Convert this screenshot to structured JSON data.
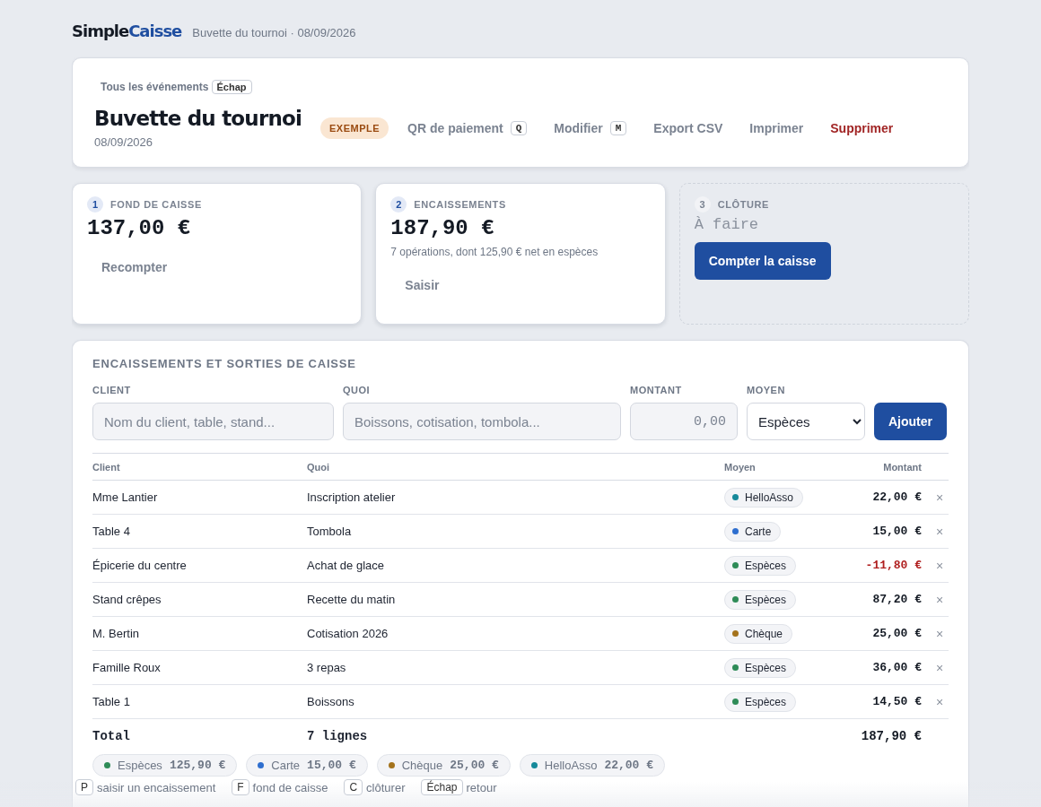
{
  "brand": {
    "first": "Simple",
    "second": "Caisse"
  },
  "breadcrumb": "Buvette du tournoi · 08/09/2026",
  "event": {
    "back_link": "Tous les événements",
    "back_key": "Échap",
    "title": "Buvette du tournoi",
    "date": "08/09/2026",
    "badge": "EXEMPLE",
    "actions": [
      {
        "label": "QR de paiement",
        "key": "Q",
        "kind": "normal"
      },
      {
        "label": "Modifier",
        "key": "M",
        "kind": "normal"
      },
      {
        "label": "Export CSV",
        "kind": "normal"
      },
      {
        "label": "Imprimer",
        "kind": "normal"
      },
      {
        "label": "Supprimer",
        "kind": "danger"
      }
    ]
  },
  "steps": [
    {
      "number": "1",
      "title": "FOND DE CAISSE",
      "done": true,
      "value": "137,00 €",
      "action": {
        "label": "Recompter",
        "kind": "link"
      }
    },
    {
      "number": "2",
      "title": "ENCAISSEMENTS",
      "done": true,
      "value": "187,90 €",
      "note": "7 opérations, dont 125,90 € net en espèces",
      "action": {
        "label": "Saisir",
        "kind": "link"
      }
    },
    {
      "number": "3",
      "title": "CLÔTURE",
      "done": false,
      "value": "À faire",
      "action": {
        "label": "Compter la caisse",
        "kind": "primary"
      }
    }
  ],
  "ledger": {
    "title": "ENCAISSEMENTS ET SORTIES DE CAISSE",
    "form": {
      "client": {
        "label": "CLIENT",
        "placeholder": "Nom du client, table, stand..."
      },
      "what": {
        "label": "QUOI",
        "placeholder": "Boissons, cotisation, tombola..."
      },
      "amount": {
        "label": "MONTANT",
        "placeholder": "0,00"
      },
      "method": {
        "label": "MOYEN",
        "value": "Espèces"
      },
      "submit": "Ajouter"
    },
    "columns": [
      "Client",
      "Quoi",
      "Moyen",
      "Montant"
    ],
    "rows": [
      {
        "client": "Mme Lantier",
        "what": "Inscription atelier",
        "method": "HelloAsso",
        "color": "#16899a",
        "amount": "22,00 €",
        "negative": false,
        "delete": "×"
      },
      {
        "client": "Table 4",
        "what": "Tombola",
        "method": "Carte",
        "color": "#2f6fcf",
        "amount": "15,00 €",
        "negative": false,
        "delete": "×"
      },
      {
        "client": "Épicerie du centre",
        "what": "Achat de glace",
        "method": "Espèces",
        "color": "#2e8b57",
        "amount": "-11,80 €",
        "negative": true,
        "delete": "×"
      },
      {
        "client": "Stand crêpes",
        "what": "Recette du matin",
        "method": "Espèces",
        "color": "#2e8b57",
        "amount": "87,20 €",
        "negative": false,
        "delete": "×"
      },
      {
        "client": "M. Bertin",
        "what": "Cotisation 2026",
        "method": "Chèque",
        "color": "#a4731c",
        "amount": "25,00 €",
        "negative": false,
        "delete": "×"
      },
      {
        "client": "Famille Roux",
        "what": "3 repas",
        "method": "Espèces",
        "color": "#2e8b57",
        "amount": "36,00 €",
        "negative": false,
        "delete": "×"
      },
      {
        "client": "Table 1",
        "what": "Boissons",
        "method": "Espèces",
        "color": "#2e8b57",
        "amount": "14,50 €",
        "negative": false,
        "delete": "×"
      }
    ],
    "total": {
      "label": "Total",
      "lines": "7 lignes",
      "amount": "187,90 €"
    },
    "summary": [
      {
        "method": "Espèces",
        "color": "#2e8b57",
        "amount": "125,90 €"
      },
      {
        "method": "Carte",
        "color": "#2f6fcf",
        "amount": "15,00 €"
      },
      {
        "method": "Chèque",
        "color": "#a4731c",
        "amount": "25,00 €"
      },
      {
        "method": "HelloAsso",
        "color": "#16899a",
        "amount": "22,00 €"
      }
    ]
  },
  "shortcuts": [
    {
      "key": "P",
      "label": "saisir un encaissement"
    },
    {
      "key": "F",
      "label": "fond de caisse"
    },
    {
      "key": "C",
      "label": "clôturer"
    },
    {
      "key": "Échap",
      "label": "retour"
    }
  ]
}
